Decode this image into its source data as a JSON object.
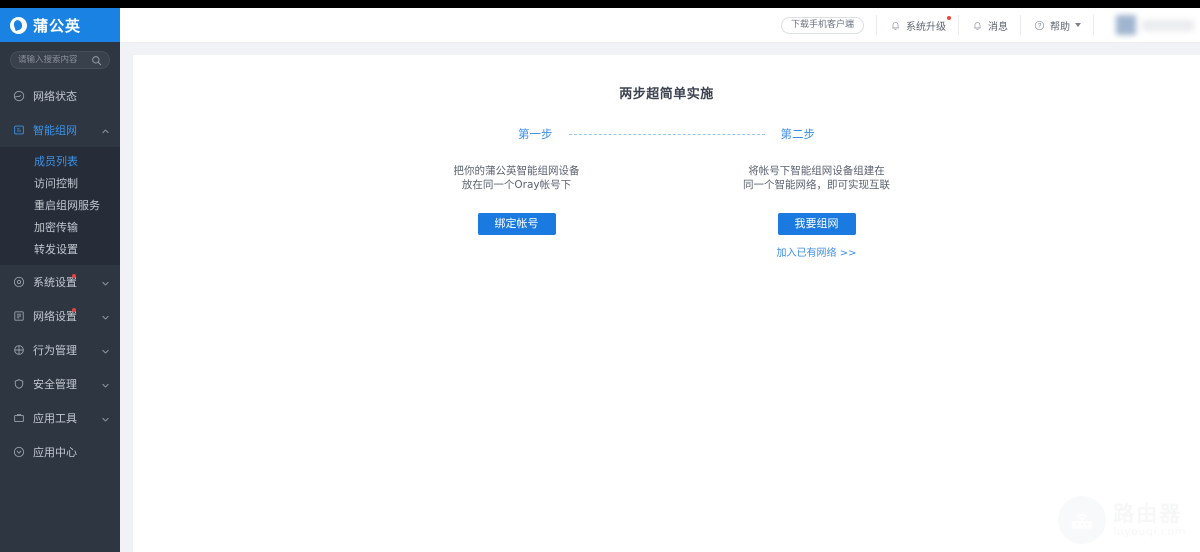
{
  "brand": {
    "logo_text": "蒲公英",
    "logo_icon": "dandelion-logo-icon",
    "accent_blue": "#1a82e2",
    "sidebar_bg": "#2e3642",
    "button_blue": "#1a7ae0"
  },
  "sidebar": {
    "search": {
      "placeholder": "请输入搜索内容",
      "value": "",
      "icon": "search-icon"
    },
    "items": [
      {
        "label": "网络状态",
        "icon": "network-status-icon",
        "expandable": false,
        "active": false,
        "badge": false
      },
      {
        "label": "智能组网",
        "icon": "smart-network-icon",
        "expandable": true,
        "active": true,
        "badge": false
      },
      {
        "label": "系统设置",
        "icon": "system-settings-icon",
        "expandable": true,
        "active": false,
        "badge": true
      },
      {
        "label": "网络设置",
        "icon": "network-settings-icon",
        "expandable": true,
        "active": false,
        "badge": true
      },
      {
        "label": "行为管理",
        "icon": "behavior-management-icon",
        "expandable": true,
        "active": false,
        "badge": false
      },
      {
        "label": "安全管理",
        "icon": "security-management-icon",
        "expandable": true,
        "active": false,
        "badge": false
      },
      {
        "label": "应用工具",
        "icon": "app-tools-icon",
        "expandable": true,
        "active": false,
        "badge": false
      },
      {
        "label": "应用中心",
        "icon": "app-center-icon",
        "expandable": false,
        "active": false,
        "badge": false
      }
    ],
    "submenu": [
      {
        "label": "成员列表",
        "active": true
      },
      {
        "label": "访问控制",
        "active": false
      },
      {
        "label": "重启组网服务",
        "active": false
      },
      {
        "label": "加密传输",
        "active": false
      },
      {
        "label": "转发设置",
        "active": false
      }
    ]
  },
  "topbar": {
    "download_app": "下载手机客户端",
    "system_upgrade": {
      "label": "系统升级",
      "icon": "upgrade-bell-icon",
      "has_badge": true
    },
    "messages": {
      "label": "消息",
      "icon": "bell-icon"
    },
    "help": {
      "label": "帮助",
      "icon": "question-circle-icon"
    },
    "user": {
      "avatar": "user-avatar",
      "name": ""
    }
  },
  "content": {
    "title": "两步超简单实施",
    "step_one_label": "第一步",
    "step_two_label": "第二步",
    "left": {
      "desc_line1": "把你的蒲公英智能组网设备",
      "desc_line2": "放在同一个Oray帐号下",
      "button": "绑定帐号"
    },
    "right": {
      "desc_line1": "将帐号下智能组网设备组建在",
      "desc_line2": "同一个智能网络，即可实现互联",
      "button": "我要组网",
      "link": "加入已有网络 >>"
    }
  },
  "watermark": {
    "cn": "路由器",
    "en": "luyouqi.com",
    "icon": "router-icon"
  }
}
